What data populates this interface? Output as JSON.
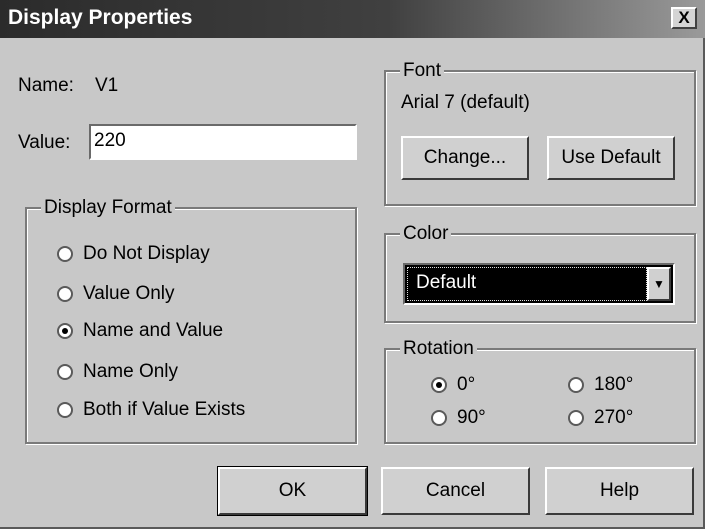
{
  "window": {
    "title": "Display Properties",
    "close_glyph": "X"
  },
  "name_row": {
    "label": "Name:",
    "value": "V1"
  },
  "value_row": {
    "label": "Value:",
    "value": "220"
  },
  "display_format": {
    "title": "Display Format",
    "options": [
      {
        "label": "Do Not Display",
        "checked": false
      },
      {
        "label": "Value Only",
        "checked": false
      },
      {
        "label": "Name and Value",
        "checked": true
      },
      {
        "label": "Name Only",
        "checked": false
      },
      {
        "label": "Both if Value Exists",
        "checked": false
      }
    ]
  },
  "font": {
    "title": "Font",
    "current": "Arial 7 (default)",
    "change_label": "Change...",
    "use_default_label": "Use Default"
  },
  "color": {
    "title": "Color",
    "selected": "Default",
    "arrow_icon": "chevron-down-icon"
  },
  "rotation": {
    "title": "Rotation",
    "options": [
      {
        "label": "0°",
        "checked": true
      },
      {
        "label": "180°",
        "checked": false
      },
      {
        "label": "90°",
        "checked": false
      },
      {
        "label": "270°",
        "checked": false
      }
    ]
  },
  "buttons": {
    "ok": "OK",
    "cancel": "Cancel",
    "help": "Help"
  }
}
